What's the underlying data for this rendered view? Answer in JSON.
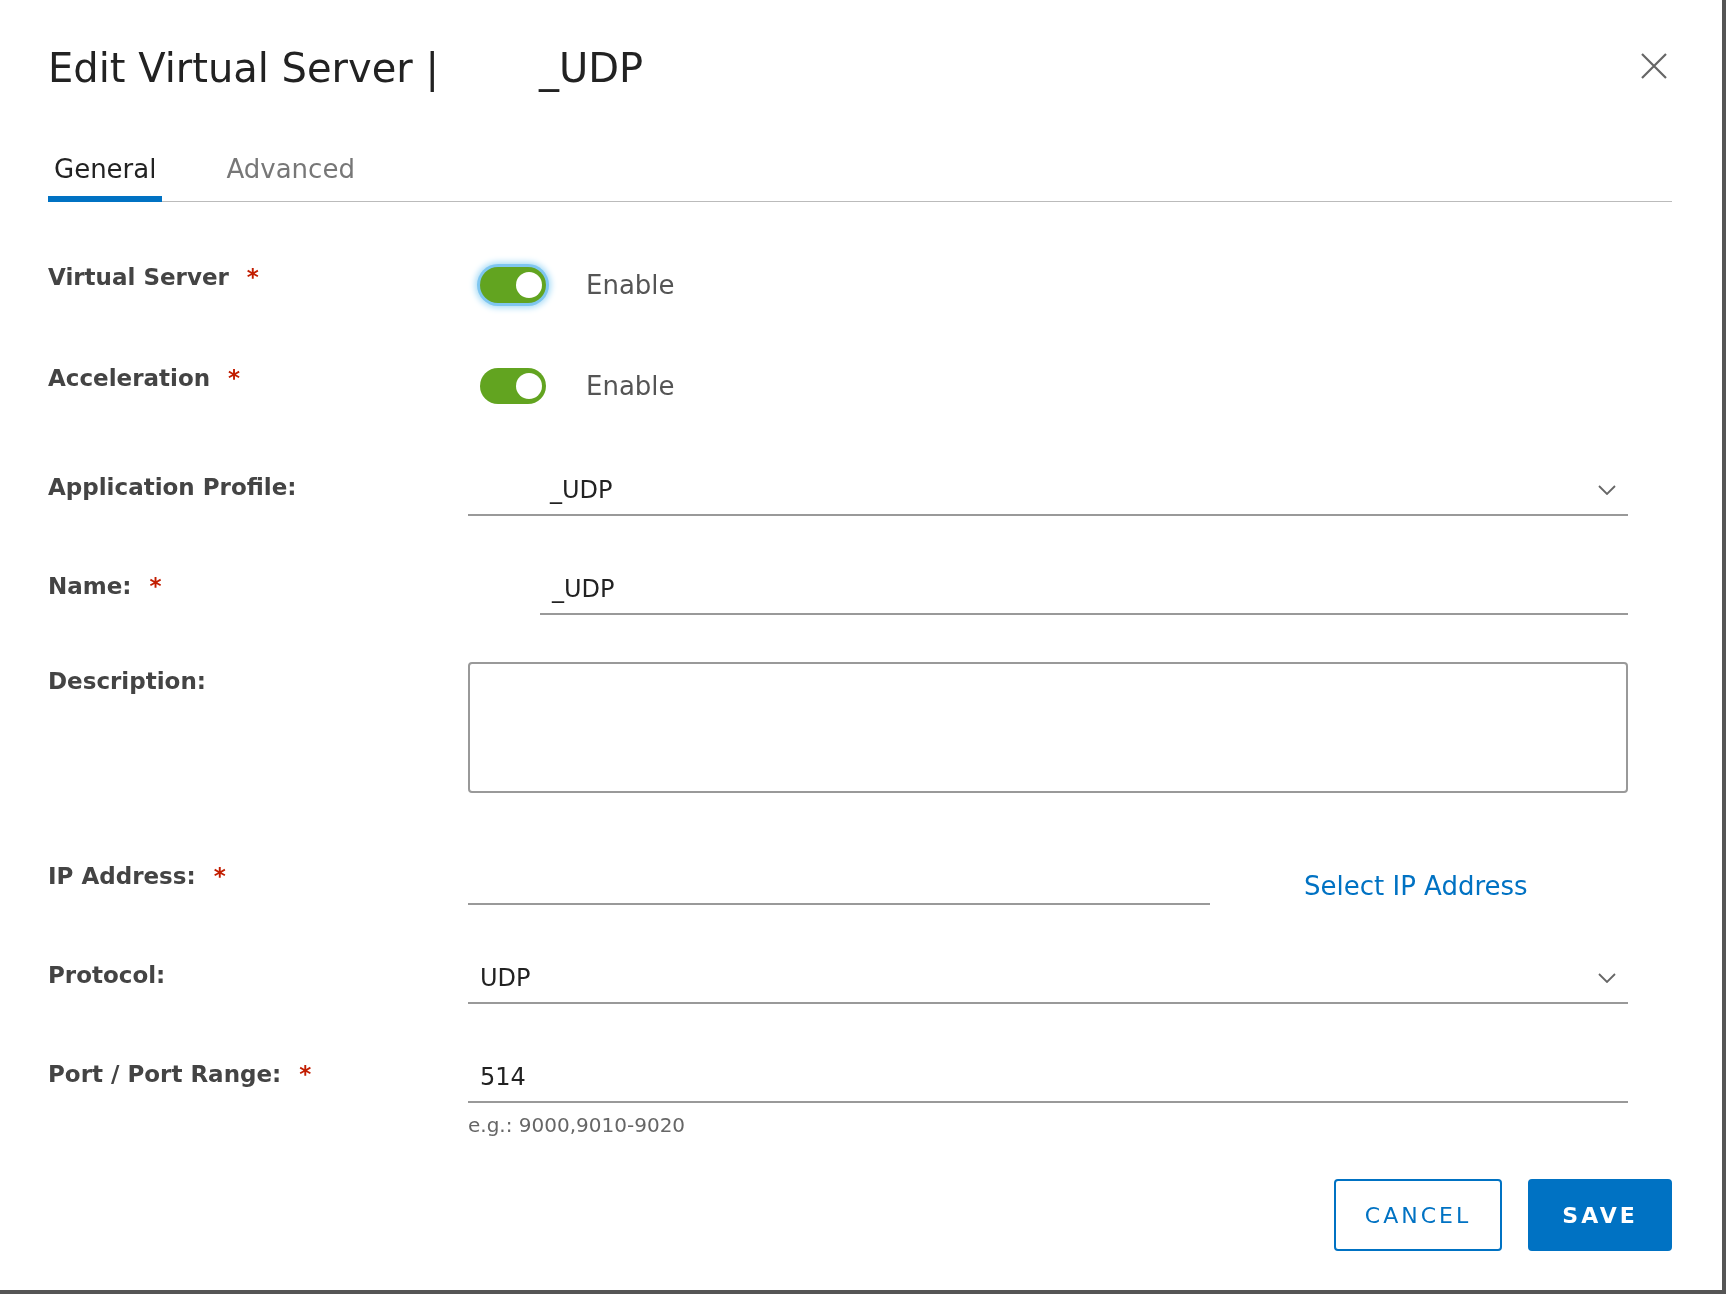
{
  "dialog": {
    "title": "Edit Virtual Server |",
    "title_name": "_UDP",
    "tabs": [
      {
        "label": "General",
        "selected": true
      },
      {
        "label": "Advanced",
        "selected": false
      }
    ],
    "fields": [
      {
        "kind": "toggle",
        "label": "Virtual Server",
        "required": "*",
        "on": true,
        "focused": true,
        "text": "Enable"
      },
      {
        "kind": "toggle",
        "label": "Acceleration",
        "required": "*",
        "on": true,
        "focused": false,
        "text": "Enable"
      },
      {
        "kind": "select",
        "label": "Application Profile:",
        "value": "_UDP",
        "redacted_prefix": true
      },
      {
        "kind": "text",
        "label": "Name:",
        "required": "*",
        "value": "_UDP",
        "redacted_prefix": true
      },
      {
        "kind": "textarea",
        "label": "Description:"
      },
      {
        "kind": "ip",
        "label": "IP Address:",
        "required": "*",
        "link": "Select IP Address"
      },
      {
        "kind": "select",
        "label": "Protocol:",
        "value": "UDP",
        "redacted_prefix": false
      },
      {
        "kind": "text",
        "label": "Port / Port Range:",
        "required": "*",
        "value": "514",
        "redacted_prefix": false,
        "hint": "e.g.: 9000,9010-9020"
      }
    ],
    "buttons": [
      {
        "label": "CANCEL",
        "kind": "secondary"
      },
      {
        "label": "SAVE",
        "kind": "primary"
      }
    ]
  }
}
